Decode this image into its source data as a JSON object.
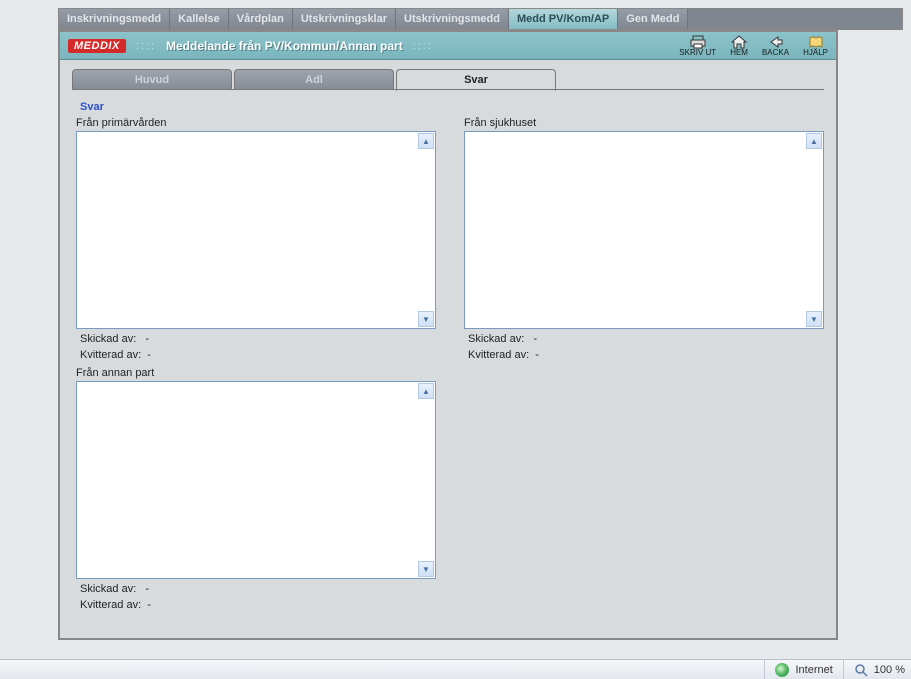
{
  "top_tabs": {
    "items": [
      {
        "label": "Inskrivningsmedd"
      },
      {
        "label": "Kallelse"
      },
      {
        "label": "Vårdplan"
      },
      {
        "label": "Utskrivningsklar"
      },
      {
        "label": "Utskrivningsmedd"
      },
      {
        "label": "Medd PV/Kom/AP"
      },
      {
        "label": "Gen Medd"
      }
    ],
    "active_index": 5
  },
  "header": {
    "logo": "MEDDIX",
    "title": "Meddelande från PV/Kommun/Annan part",
    "tools": {
      "print": "SKRIV UT",
      "home": "HEM",
      "back": "BACKA",
      "help": "HJÄLP"
    }
  },
  "sub_tabs": {
    "items": [
      {
        "label": "Huvud"
      },
      {
        "label": "Adl"
      },
      {
        "label": "Svar"
      }
    ],
    "active_index": 2
  },
  "section": {
    "title": "Svar",
    "primarvarden": {
      "label": "Från primärvården",
      "value": "",
      "skickad_label": "Skickad av:",
      "skickad_value": "-",
      "kvitterad_label": "Kvitterad av:",
      "kvitterad_value": "-"
    },
    "sjukhuset": {
      "label": "Från sjukhuset",
      "value": "",
      "skickad_label": "Skickad av:",
      "skickad_value": "-",
      "kvitterad_label": "Kvitterad av:",
      "kvitterad_value": "-"
    },
    "annan": {
      "label": "Från annan part",
      "value": "",
      "skickad_label": "Skickad av:",
      "skickad_value": "-",
      "kvitterad_label": "Kvitterad av:",
      "kvitterad_value": "-"
    }
  },
  "status": {
    "zone": "Internet",
    "zoom": "100 %"
  }
}
